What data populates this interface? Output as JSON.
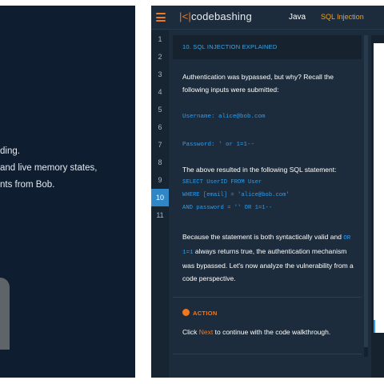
{
  "left": {
    "lines": [
      "ding.",
      "and live memory states,",
      "nts from Bob."
    ]
  },
  "app": {
    "logo_mark": "|<|",
    "logo_name": "codebashing",
    "logo_ext": "",
    "nav_java": "Java",
    "nav_sqli": "SQL Injection"
  },
  "steps": [
    "1",
    "2",
    "3",
    "4",
    "5",
    "6",
    "7",
    "8",
    "9",
    "10",
    "11"
  ],
  "active_step": "10",
  "lesson": {
    "header": "10. SQL INJECTION EXPLAINED",
    "intro": "Authentication was bypassed, but why? Recall the following inputs were submitted:",
    "username_label": "Username",
    "username_value": "alice@bob.com",
    "password_label": "Password",
    "password_value": "' or 1=1--",
    "result_text": "The above resulted in the following SQL statement:",
    "sql": [
      "SELECT UserID FROM User",
      "WHERE [email] = 'alice@bob.com'",
      "AND password = '' OR 1=1--"
    ],
    "explain_pre": "Because the statement is both syntactically valid and",
    "explain_code": "OR 1=1",
    "explain_post": "always returns true, the authentication mechanism was bypassed. Let's now analyze the vulnerability from a code perspective.",
    "action_title": "ACTION",
    "action_pre": "Click ",
    "action_link": "Next",
    "action_post": " to continue with the code walkthrough."
  },
  "colors": {
    "accent": "#f0781e",
    "code_blue": "#2f9cec",
    "bg_dark": "#1c2c3c"
  }
}
